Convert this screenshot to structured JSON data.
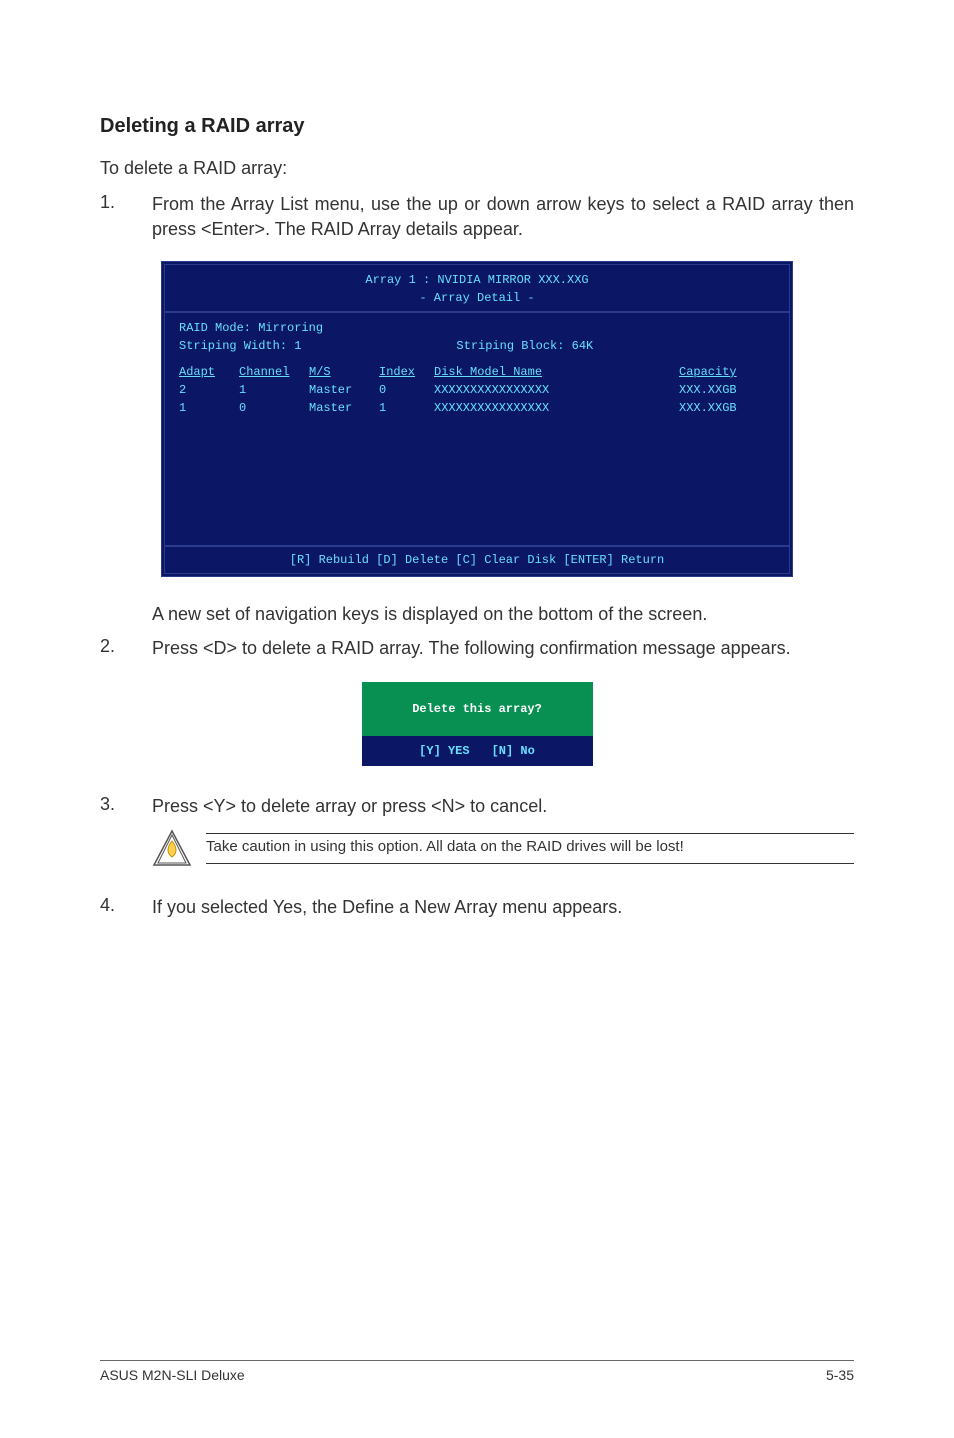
{
  "heading": "Deleting a RAID array",
  "intro": "To delete a RAID array:",
  "step1_num": "1.",
  "step1_text": "From the Array List menu, use the up or down arrow keys to select a RAID array then press <Enter>. The RAID Array details appear.",
  "bios": {
    "title1": "Array 1 : NVIDIA MIRROR  XXX.XXG",
    "title2": "- Array Detail -",
    "mode": "RAID Mode: Mirroring",
    "sw": "Striping Width: 1",
    "sb": "Striping Block: 64K",
    "h_adapt": "Adapt",
    "h_channel": "Channel",
    "h_ms": "M/S",
    "h_index": "Index",
    "h_model": "Disk Model Name",
    "h_cap": "Capacity",
    "rows": [
      {
        "adapt": "2",
        "channel": "1",
        "ms": "Master",
        "index": "0",
        "model": "XXXXXXXXXXXXXXXX",
        "cap": "XXX.XXGB"
      },
      {
        "adapt": "1",
        "channel": "0",
        "ms": "Master",
        "index": "1",
        "model": "XXXXXXXXXXXXXXXX",
        "cap": "XXX.XXGB"
      }
    ],
    "footer": "[R] Rebuild  [D] Delete  [C] Clear Disk  [ENTER] Return"
  },
  "step1_post": "A new set of  navigation keys is displayed on the bottom of the screen.",
  "step2_num": "2.",
  "step2_text": "Press <D> to delete a RAID array. The following confirmation message appears.",
  "dialog": {
    "question": "Delete this array?",
    "yes": "[Y] YES",
    "no": "[N] No"
  },
  "step3_num": "3.",
  "step3_text": "Press <Y> to delete array or press <N> to cancel.",
  "warning": "Take caution in using this option. All data on the RAID drives will be lost!",
  "step4_num": "4.",
  "step4_text": "If you selected Yes, the Define a New Array menu appears.",
  "footer_left": "ASUS M2N-SLI Deluxe",
  "footer_right": "5-35"
}
